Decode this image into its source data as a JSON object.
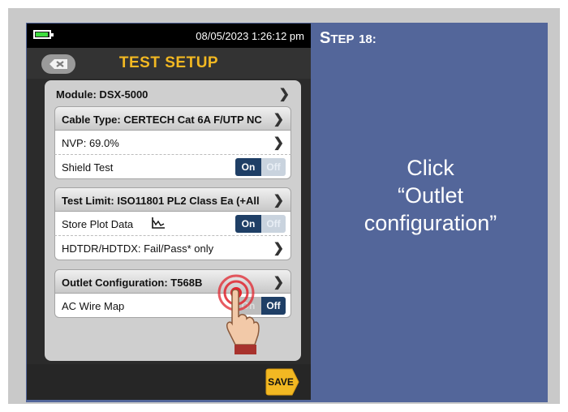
{
  "status": {
    "datetime": "08/05/2023 1:26:12 pm"
  },
  "header": {
    "title": "TEST SETUP"
  },
  "settings": {
    "module": "Module: DSX-5000",
    "cable_type": "Cable Type: CERTECH Cat 6A F/UTP NC",
    "nvp": "NVP: 69.0%",
    "shield_test": {
      "label": "Shield Test",
      "on": "On",
      "off": "Off",
      "state": "on"
    },
    "test_limit": "Test Limit: ISO11801 PL2 Class Ea (+All",
    "store_plot": {
      "label": "Store Plot Data",
      "on": "On",
      "off": "Off",
      "state": "on"
    },
    "hdtdr": "HDTDR/HDTDX: Fail/Pass* only",
    "outlet_config": "Outlet Configuration: T568B",
    "ac_wire_map": {
      "label": "AC Wire Map",
      "on": "On",
      "off": "Off",
      "state": "off"
    }
  },
  "footer": {
    "save": "SAVE"
  },
  "step": {
    "prefix_big": "S",
    "prefix_small": "TEP",
    "number": "18:"
  },
  "instruction": {
    "line1": "Click",
    "line2": "“Outlet",
    "line3": "configuration”"
  },
  "colors": {
    "accent": "#f2b822",
    "panel": "#53669a",
    "toggle_on": "#1f3f66",
    "ripple": "#e0262f"
  },
  "icons": [
    "battery-icon",
    "back-icon",
    "chevron-right-icon",
    "plot-icon",
    "touch-ripple-icon",
    "hand-pointer-icon"
  ]
}
